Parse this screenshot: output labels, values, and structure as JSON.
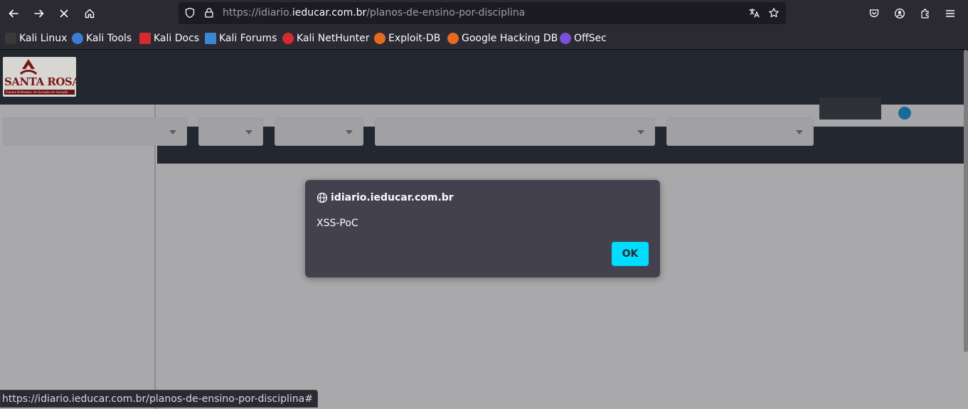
{
  "browser": {
    "url_prefix": "https://idiario.",
    "url_domain": "ieducar.com.br",
    "url_path": "/planos-de-ensino-por-disciplina"
  },
  "bookmarks": [
    {
      "label": "Kali Linux",
      "icon": "kali-dragon-icon",
      "color": "#cfcfcf"
    },
    {
      "label": "Kali Tools",
      "icon": "kali-tools-icon",
      "color": "#3b7bd6"
    },
    {
      "label": "Kali Docs",
      "icon": "kali-docs-icon",
      "color": "#d42c2c"
    },
    {
      "label": "Kali Forums",
      "icon": "kali-forums-icon",
      "color": "#3b87d6"
    },
    {
      "label": "Kali NetHunter",
      "icon": "kali-nethunter-icon",
      "color": "#d42c2c"
    },
    {
      "label": "Exploit-DB",
      "icon": "exploit-db-icon",
      "color": "#e46a1f"
    },
    {
      "label": "Google Hacking DB",
      "icon": "ghdb-icon",
      "color": "#e46a1f"
    },
    {
      "label": "OffSec",
      "icon": "offsec-icon",
      "color": "#7c4fd8"
    }
  ],
  "logo": {
    "name": "SANTA ROSA",
    "tagline": "Futuros Brilhantes, de Geração em Geração"
  },
  "dialog": {
    "origin": "idiario.ieducar.com.br",
    "message": "XSS-PoC",
    "ok_label": "OK",
    "accent": "#00ddff"
  },
  "status_bar": {
    "link": "https://idiario.ieducar.com.br/planos-de-ensino-por-disciplina#"
  }
}
